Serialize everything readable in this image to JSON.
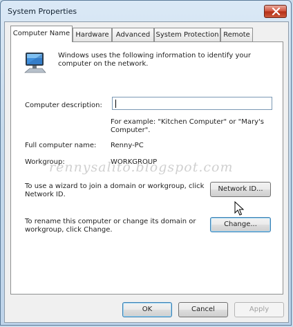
{
  "window": {
    "title": "System Properties"
  },
  "tabs": [
    {
      "label": "Computer Name"
    },
    {
      "label": "Hardware"
    },
    {
      "label": "Advanced"
    },
    {
      "label": "System Protection"
    },
    {
      "label": "Remote"
    }
  ],
  "panel": {
    "intro_text": "Windows uses the following information to identify your computer on the network.",
    "computer_description": {
      "label": "Computer description:",
      "value": "",
      "example": "For example: \"Kitchen Computer\" or \"Mary's Computer\"."
    },
    "full_computer_name": {
      "label": "Full computer name:",
      "value": "Renny-PC"
    },
    "workgroup": {
      "label": "Workgroup:",
      "value": "WORKGROUP"
    },
    "network_id": {
      "text": "To use a wizard to join a domain or workgroup, click Network ID.",
      "button_label": "Network ID..."
    },
    "rename": {
      "text": "To rename this computer or change its domain or workgroup, click Change.",
      "button_label": "Change..."
    }
  },
  "buttons": {
    "ok": "OK",
    "cancel": "Cancel",
    "apply": "Apply"
  },
  "watermark": "rennysalito.blogspot.com",
  "icons": {
    "computer": "computer-icon",
    "close": "close-icon",
    "cursor": "mouse-cursor-icon"
  }
}
